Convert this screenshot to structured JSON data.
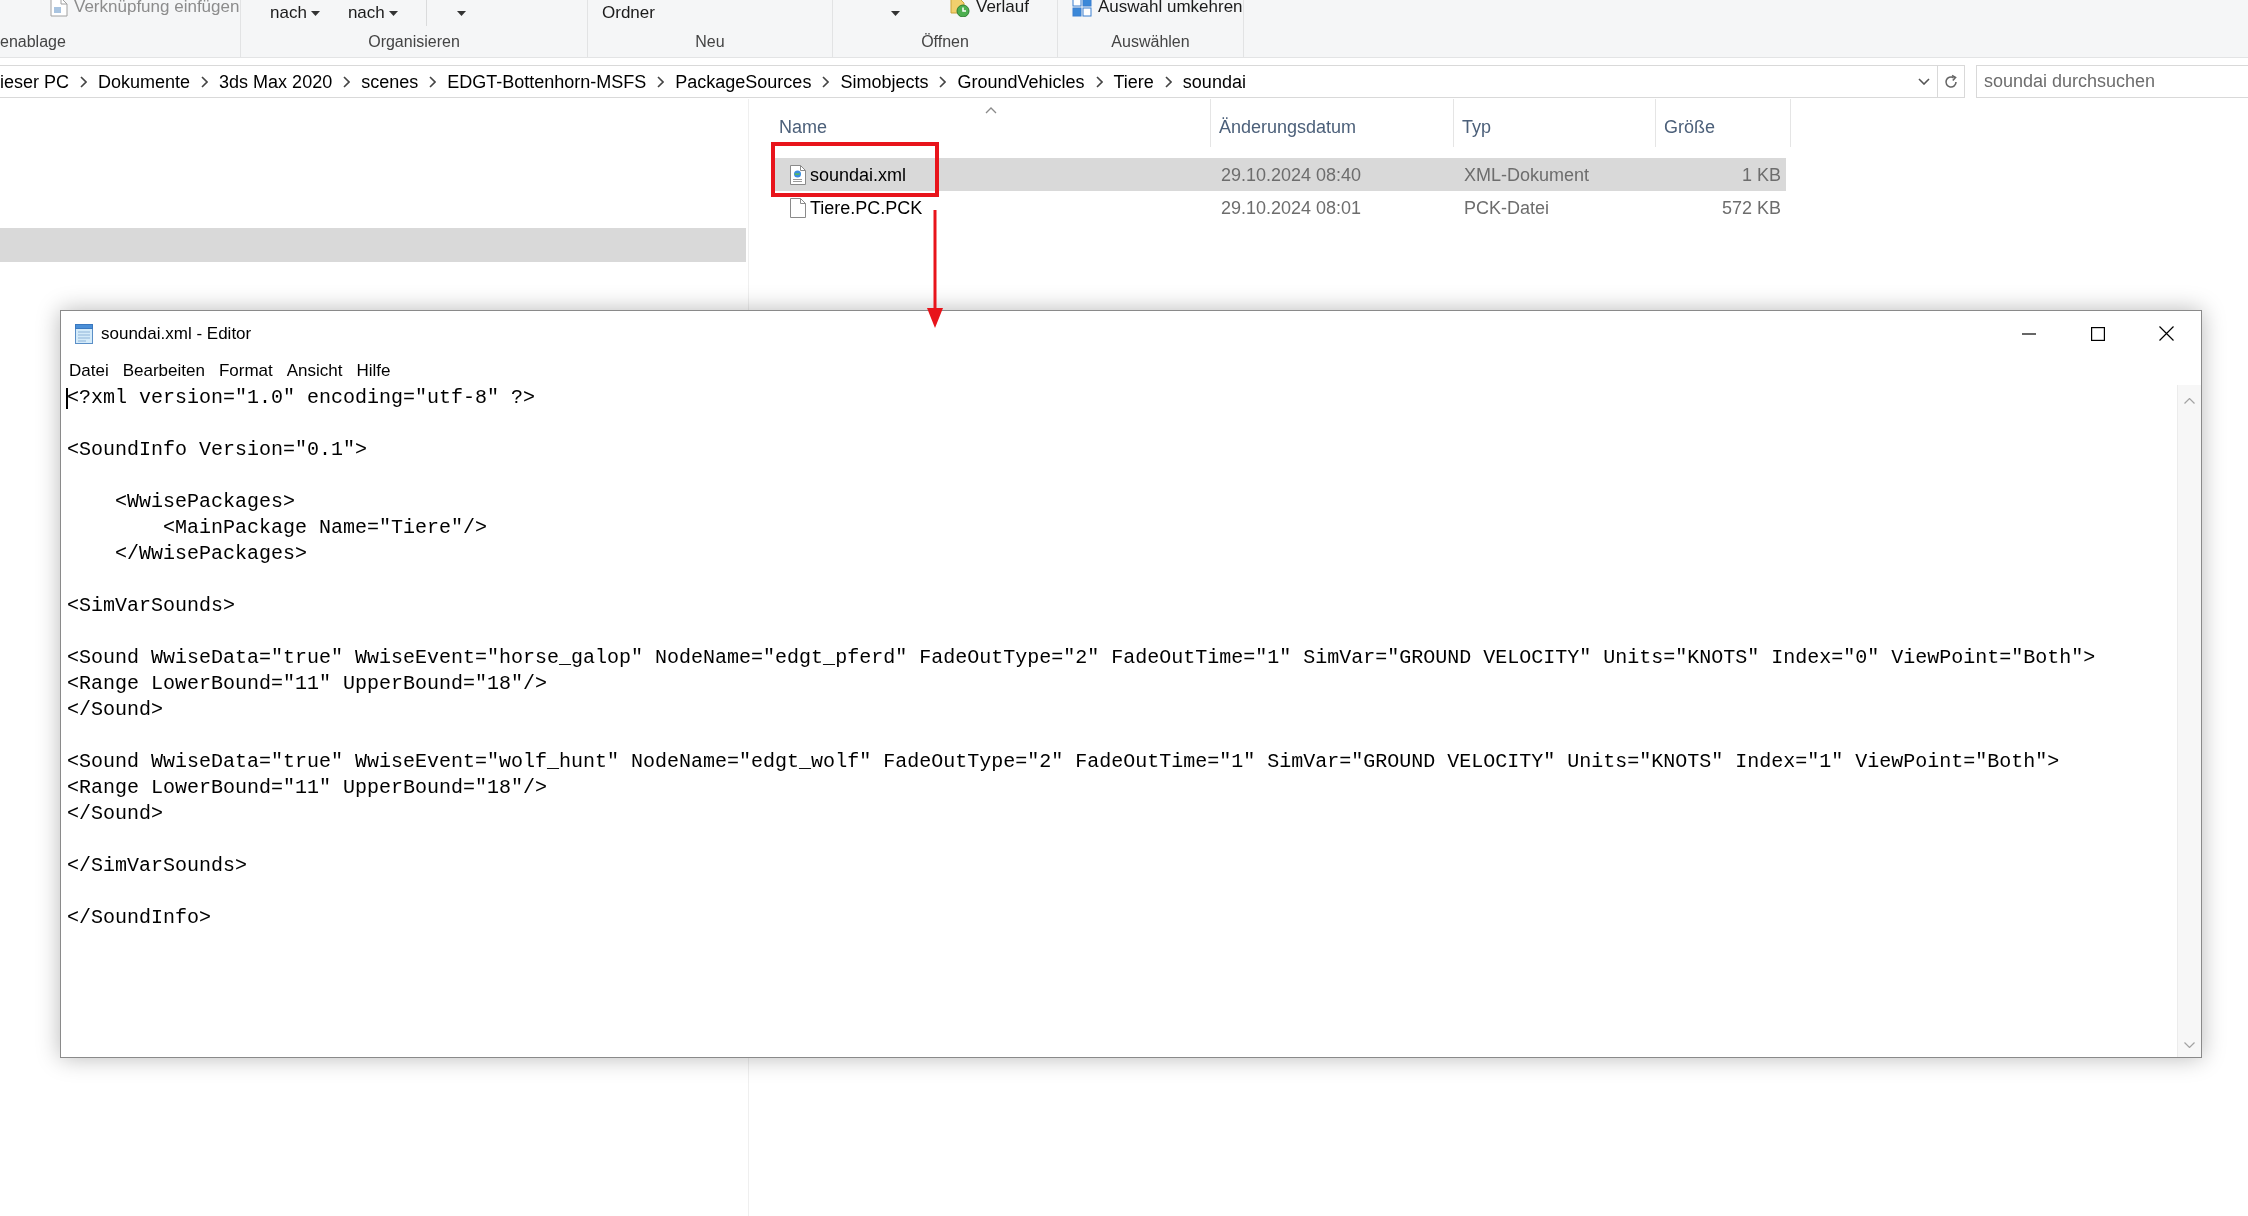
{
  "ribbon": {
    "groups": [
      {
        "label": "enablage",
        "items": [
          {
            "kind": "small",
            "label": "Verknüpfung einfügen",
            "disabled": true
          }
        ]
      },
      {
        "label": "Organisieren",
        "items": [
          {
            "kind": "dropdown",
            "label": "nach",
            "disabled": false
          },
          {
            "kind": "dropdown",
            "label": "nach",
            "disabled": false
          },
          {
            "kind": "separator"
          },
          {
            "kind": "caret",
            "disabled": false
          }
        ]
      },
      {
        "label": "Neu",
        "items": [
          {
            "kind": "large",
            "label": "Ordner",
            "disabled": false
          }
        ]
      },
      {
        "label": "Öffnen",
        "items": [
          {
            "kind": "caret",
            "disabled": false
          },
          {
            "kind": "small",
            "label": "Verlauf",
            "disabled": false
          }
        ]
      },
      {
        "label": "Auswählen",
        "items": [
          {
            "kind": "small",
            "label": "Auswahl umkehren",
            "disabled": false
          }
        ]
      }
    ]
  },
  "address_bar": {
    "path": [
      "ieser PC",
      "Dokumente",
      "3ds Max 2020",
      "scenes",
      "EDGT-Bottenhorn-MSFS",
      "PackageSources",
      "Simobjects",
      "GroundVehicles",
      "Tiere",
      "soundai"
    ]
  },
  "search": {
    "placeholder": "soundai durchsuchen"
  },
  "navigation_pane": {
    "highlighted_row": true
  },
  "file_list": {
    "columns": [
      {
        "label": "Name",
        "sorted": true
      },
      {
        "label": "Änderungsdatum",
        "sorted": false
      },
      {
        "label": "Typ",
        "sorted": false
      },
      {
        "label": "Größe",
        "sorted": false
      }
    ],
    "rows": [
      {
        "kind": "xml",
        "name": "soundai.xml",
        "modified": "29.10.2024 08:40",
        "type": "XML-Dokument",
        "size": "1 KB",
        "selected": true,
        "highlighted": true
      },
      {
        "kind": "file",
        "name": "Tiere.PC.PCK",
        "modified": "29.10.2024 08:01",
        "type": "PCK-Datei",
        "size": "572 KB",
        "selected": false,
        "highlighted": false
      }
    ]
  },
  "editor": {
    "title": "soundai.xml - Editor",
    "menu": [
      "Datei",
      "Bearbeiten",
      "Format",
      "Ansicht",
      "Hilfe"
    ],
    "text": "<?xml version=\"1.0\" encoding=\"utf-8\" ?>\n\n<SoundInfo Version=\"0.1\">\n\n    <WwisePackages>\n        <MainPackage Name=\"Tiere\"/>\n    </WwisePackages>\n\n<SimVarSounds>\n\n<Sound WwiseData=\"true\" WwiseEvent=\"horse_galop\" NodeName=\"edgt_pferd\" FadeOutType=\"2\" FadeOutTime=\"1\" SimVar=\"GROUND VELOCITY\" Units=\"KNOTS\" Index=\"0\" ViewPoint=\"Both\">\n<Range LowerBound=\"11\" UpperBound=\"18\"/>\n</Sound>\n\n<Sound WwiseData=\"true\" WwiseEvent=\"wolf_hunt\" NodeName=\"edgt_wolf\" FadeOutType=\"2\" FadeOutTime=\"1\" SimVar=\"GROUND VELOCITY\" Units=\"KNOTS\" Index=\"1\" ViewPoint=\"Both\">\n<Range LowerBound=\"11\" UpperBound=\"18\"/>\n</Sound>\n\n</SimVarSounds>\n\n</SoundInfo>"
  }
}
